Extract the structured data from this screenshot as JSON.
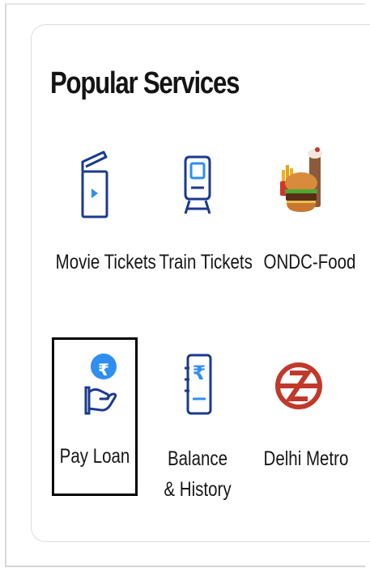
{
  "section": {
    "title": "Popular Services"
  },
  "services": [
    {
      "label": "Movie Tickets",
      "icon": "movie-clapper-icon"
    },
    {
      "label": "Train Tickets",
      "icon": "train-icon"
    },
    {
      "label": "ONDC-Food",
      "icon": "food-burger-icon"
    },
    {
      "label": "Pay Loan",
      "icon": "pay-loan-icon",
      "badge": "₹"
    },
    {
      "label_line1": "Balance",
      "label_line2": "& History",
      "icon": "balance-history-icon",
      "glyph": "₹"
    },
    {
      "label": "Delhi Metro",
      "icon": "delhi-metro-icon"
    }
  ],
  "colors": {
    "icon_blue": "#1a3a8f",
    "accent_blue": "#2f8ff0",
    "metro_red": "#c0392b"
  }
}
